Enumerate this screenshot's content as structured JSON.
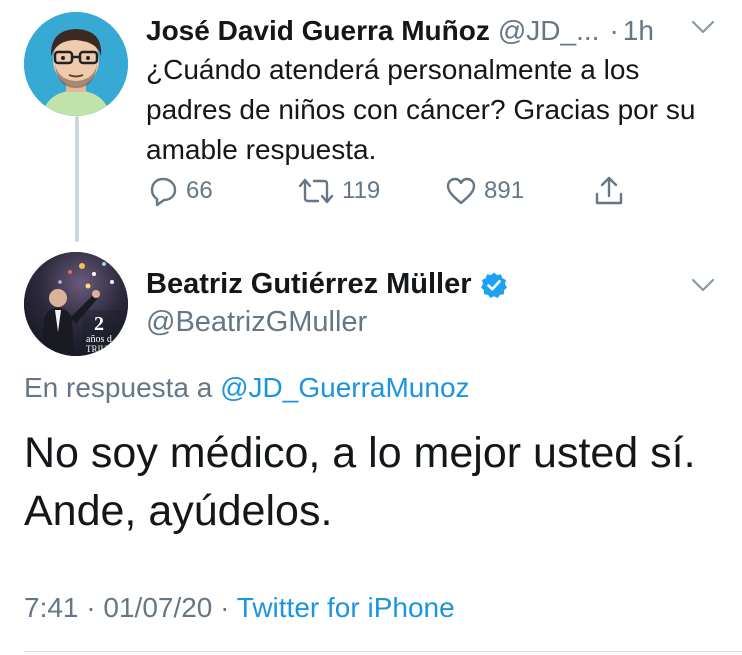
{
  "tweet_parent": {
    "author_name": "José David Guerra Muñoz",
    "author_handle": "@JD_...",
    "separator": "·",
    "time": "1h",
    "text": "¿Cuándo atenderá personalmente a los padres de niños con cáncer? Gracias por su amable respuesta.",
    "actions": {
      "replies": "66",
      "retweets": "119",
      "likes": "891"
    },
    "icons": {
      "reply": "reply-icon",
      "retweet": "retweet-icon",
      "like": "heart-icon",
      "share": "share-icon",
      "menu": "chevron-down-icon"
    }
  },
  "tweet_main": {
    "author_name": "Beatriz Gutiérrez Müller",
    "author_handle": "@BeatrizGMuller",
    "verified": true,
    "avatar_overlay": {
      "number": "2",
      "line1": "años d",
      "line2": "TRIUN"
    },
    "reply_prefix": "En respuesta a",
    "reply_target": "@JD_GuerraMunoz",
    "text": "No soy médico, a lo mejor usted sí. Ande, ayúdelos.",
    "time": "7:41",
    "date": "01/07/20",
    "separator": "·",
    "source": "Twitter for iPhone"
  },
  "colors": {
    "link": "#1b95e0",
    "secondary_text": "#657786",
    "verified_badge": "#1da1f2",
    "thread_line": "#ccd6dd"
  }
}
